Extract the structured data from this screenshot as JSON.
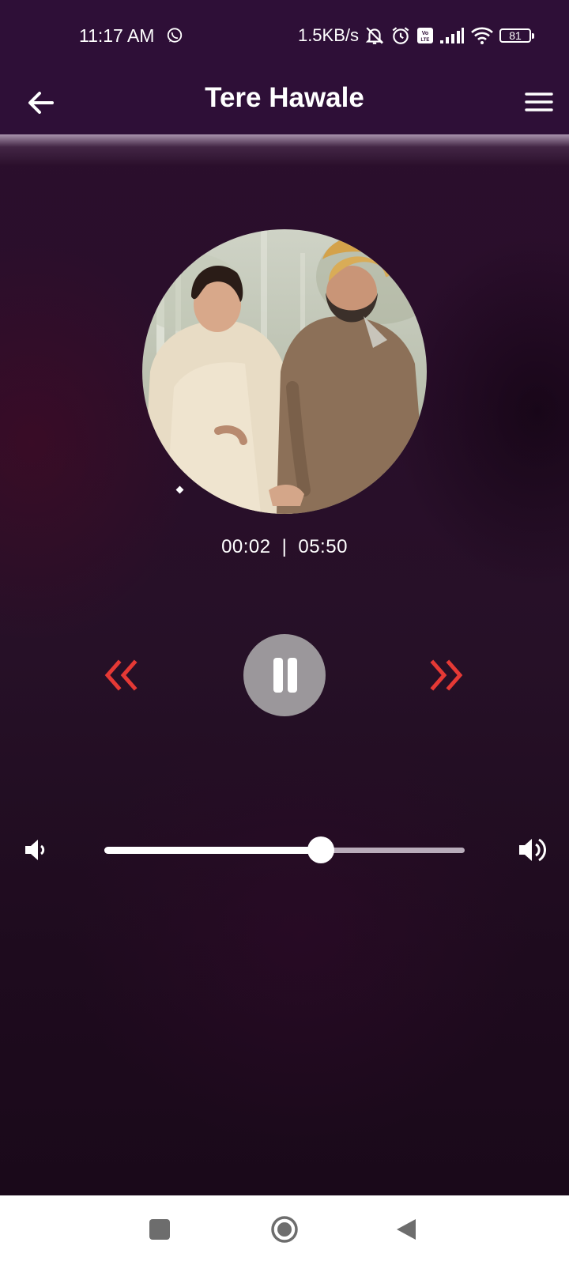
{
  "status_bar": {
    "time": "11:17 AM",
    "network_speed": "1.5KB/s",
    "battery_level": "81",
    "icons": [
      "whatsapp-icon",
      "mute-icon",
      "alarm-icon",
      "volte-icon",
      "signal-icon",
      "wifi-icon",
      "battery-icon"
    ]
  },
  "header": {
    "title": "Tere Hawale",
    "back_icon": "arrow-left-icon",
    "menu_icon": "hamburger-menu-icon"
  },
  "player": {
    "album_art": "circular album artwork",
    "elapsed": "00:02",
    "separator": "|",
    "duration": "05:50",
    "rewind_icon": "double-chevron-left-icon",
    "play_state_icon": "pause-icon",
    "forward_icon": "double-chevron-right-icon",
    "control_accent_color": "#e53935"
  },
  "volume": {
    "level": 0.6,
    "low_icon": "volume-low-icon",
    "high_icon": "volume-high-icon"
  },
  "navigation": {
    "icons": [
      "recents-square-icon",
      "home-circle-icon",
      "back-triangle-icon"
    ]
  },
  "colors": {
    "app_bar": "#2e0f37",
    "background": "#2a0e2b",
    "play_button": "#9b979b"
  }
}
